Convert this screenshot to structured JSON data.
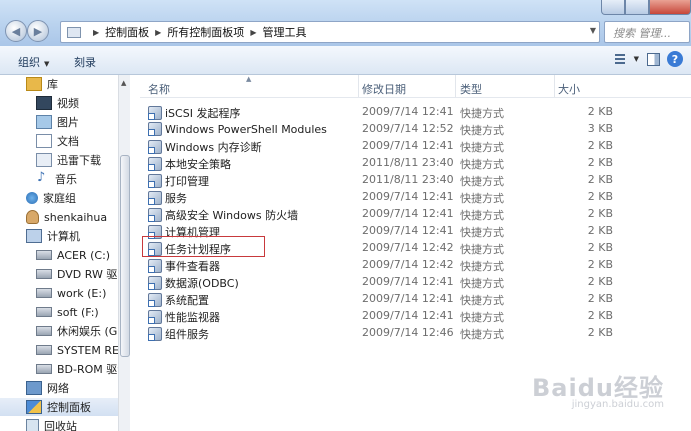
{
  "address": {
    "segments": [
      "控制面板",
      "所有控制面板项",
      "管理工具"
    ]
  },
  "search": {
    "placeholder": "搜索 管理..."
  },
  "toolbar": {
    "organize": "组织",
    "burn": "刻录"
  },
  "sidebar": {
    "items": [
      {
        "label": "库",
        "icon": "library-icon"
      },
      {
        "label": "视频",
        "icon": "video-icon"
      },
      {
        "label": "图片",
        "icon": "picture-icon"
      },
      {
        "label": "文档",
        "icon": "document-icon"
      },
      {
        "label": "迅雷下载",
        "icon": "download-icon"
      },
      {
        "label": "音乐",
        "icon": "music-icon"
      },
      {
        "label": "家庭组",
        "icon": "homegroup-icon"
      },
      {
        "label": "shenkaihua",
        "icon": "user-icon"
      },
      {
        "label": "计算机",
        "icon": "computer-icon"
      },
      {
        "label": "ACER (C:)",
        "icon": "drive-icon"
      },
      {
        "label": "DVD RW 驱动",
        "icon": "dvd-drive-icon"
      },
      {
        "label": "work (E:)",
        "icon": "drive-icon"
      },
      {
        "label": "soft (F:)",
        "icon": "drive-icon"
      },
      {
        "label": "休闲娱乐 (G:)",
        "icon": "drive-icon"
      },
      {
        "label": "SYSTEM RESE",
        "icon": "drive-icon"
      },
      {
        "label": "BD-ROM 驱动",
        "icon": "bd-drive-icon"
      },
      {
        "label": "网络",
        "icon": "network-icon"
      },
      {
        "label": "控制面板",
        "icon": "control-panel-icon"
      },
      {
        "label": "回收站",
        "icon": "recycle-bin-icon"
      }
    ]
  },
  "columns": {
    "name": "名称",
    "date": "修改日期",
    "type": "类型",
    "size": "大小"
  },
  "files": [
    {
      "name": "iSCSI 发起程序",
      "date": "2009/7/14 12:41",
      "type": "快捷方式",
      "size": "2 KB"
    },
    {
      "name": "Windows PowerShell Modules",
      "date": "2009/7/14 12:52",
      "type": "快捷方式",
      "size": "3 KB"
    },
    {
      "name": "Windows 内存诊断",
      "date": "2009/7/14 12:41",
      "type": "快捷方式",
      "size": "2 KB"
    },
    {
      "name": "本地安全策略",
      "date": "2011/8/11 23:40",
      "type": "快捷方式",
      "size": "2 KB"
    },
    {
      "name": "打印管理",
      "date": "2011/8/11 23:40",
      "type": "快捷方式",
      "size": "2 KB"
    },
    {
      "name": "服务",
      "date": "2009/7/14 12:41",
      "type": "快捷方式",
      "size": "2 KB"
    },
    {
      "name": "高级安全 Windows 防火墙",
      "date": "2009/7/14 12:41",
      "type": "快捷方式",
      "size": "2 KB"
    },
    {
      "name": "计算机管理",
      "date": "2009/7/14 12:41",
      "type": "快捷方式",
      "size": "2 KB"
    },
    {
      "name": "任务计划程序",
      "date": "2009/7/14 12:42",
      "type": "快捷方式",
      "size": "2 KB"
    },
    {
      "name": "事件查看器",
      "date": "2009/7/14 12:42",
      "type": "快捷方式",
      "size": "2 KB"
    },
    {
      "name": "数据源(ODBC)",
      "date": "2009/7/14 12:41",
      "type": "快捷方式",
      "size": "2 KB"
    },
    {
      "name": "系统配置",
      "date": "2009/7/14 12:41",
      "type": "快捷方式",
      "size": "2 KB"
    },
    {
      "name": "性能监视器",
      "date": "2009/7/14 12:41",
      "type": "快捷方式",
      "size": "2 KB"
    },
    {
      "name": "组件服务",
      "date": "2009/7/14 12:46",
      "type": "快捷方式",
      "size": "2 KB"
    }
  ],
  "watermark": {
    "brand": "Baidu经验",
    "url": "jingyan.baidu.com"
  },
  "colors": {
    "highlight_box": "#c8393c",
    "title_gradient_top": "#cfe2f6",
    "title_gradient_bottom": "#aac6e8"
  }
}
